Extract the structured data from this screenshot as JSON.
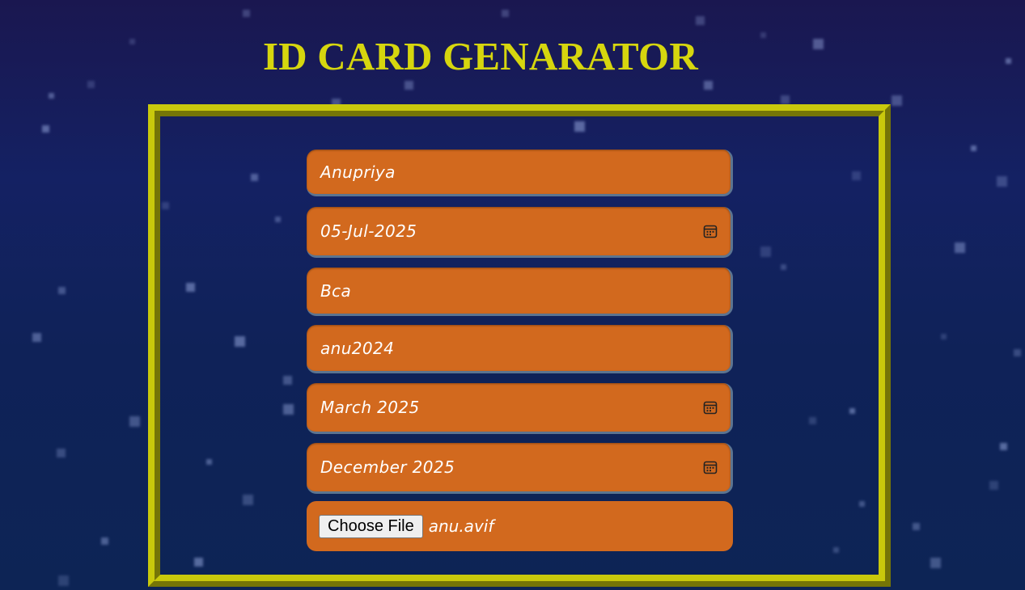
{
  "page": {
    "title": "ID CARD GENARATOR",
    "colors": {
      "title": "#d6d60e",
      "frame_border": "#c9c90c",
      "field_background": "#d2691e",
      "field_text": "#ffffff",
      "background_top": "#1a1750",
      "background_bottom": "#0d2455"
    }
  },
  "form": {
    "name_value": "Anupriya",
    "date_of_birth_value": "05-Jul-2025",
    "course_value": "Bca",
    "roll_id_value": "anu2024",
    "issue_month_value": "March 2025",
    "expiry_month_value": "December 2025",
    "file": {
      "button_label": "Choose File",
      "selected_file": "anu.avif"
    },
    "calendar_icon": "calendar-icon"
  }
}
